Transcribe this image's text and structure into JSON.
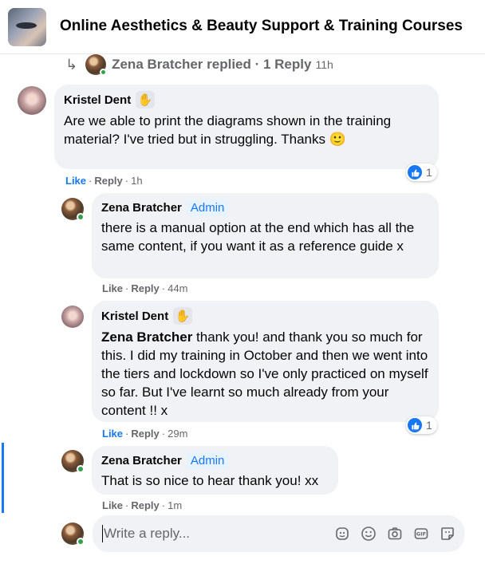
{
  "group": {
    "title": "Online Aesthetics & Beauty Support & Training Courses",
    "thumbnail_icon": "group-photo"
  },
  "replied_summary": {
    "text": "Zena Bratcher replied · 1 Reply",
    "time": "11h",
    "icon": "reply-arrow-icon"
  },
  "comments": [
    {
      "author": "Kristel Dent",
      "badge_icon": "wave-hand-icon",
      "text": "Are we able to print the diagrams shown in the training material? I've tried but in struggling. Thanks",
      "emoji": "🙂",
      "like_label": "Like",
      "reply_label": "Reply",
      "time": "1h",
      "reaction_count": "1"
    },
    {
      "author": "Zena Bratcher",
      "role": "Admin",
      "text": "there is a manual option at the end which has all the same content, if you want it as a reference guide x",
      "like_label": "Like",
      "reply_label": "Reply",
      "time": "44m"
    },
    {
      "author": "Kristel Dent",
      "badge_icon": "wave-hand-icon",
      "mention": "Zena Bratcher",
      "text": " thank you! and thank you so much for this. I did my training in October and then we went into the tiers and lockdown so I've only practiced on myself so far. But I've learnt so much already from your content !! x",
      "like_label": "Like",
      "reply_label": "Reply",
      "time": "29m",
      "reaction_count": "1"
    },
    {
      "author": "Zena Bratcher",
      "role": "Admin",
      "text": "That is so nice to hear thank you! xx",
      "like_label": "Like",
      "reply_label": "Reply",
      "time": "1m"
    }
  ],
  "composer": {
    "placeholder": "Write a reply...",
    "tools": [
      "avatar-sticker-icon",
      "emoji-icon",
      "camera-icon",
      "gif-icon",
      "sticker-icon"
    ]
  },
  "colors": {
    "accent": "#1877f2",
    "bubble": "#f0f2f5",
    "online": "#31a24c",
    "muted": "#65676b"
  }
}
